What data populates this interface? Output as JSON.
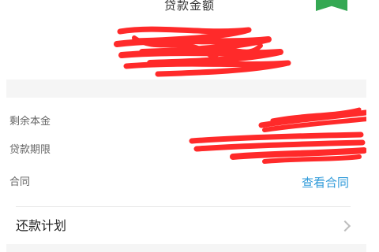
{
  "header": {
    "title": "贷款金额",
    "badge_color": "#35a853"
  },
  "loan_details": {
    "remaining_principal_label": "剩余本金",
    "loan_term_label": "贷款期限",
    "contract_label": "合同",
    "contract_link": "查看合同"
  },
  "repayment_plan": {
    "label": "还款计划",
    "icon": "chevron-right-icon"
  },
  "colors": {
    "accent_link": "#2f9ad9",
    "redaction": "#ff2a2a",
    "section_gap": "#f5f5f5"
  }
}
